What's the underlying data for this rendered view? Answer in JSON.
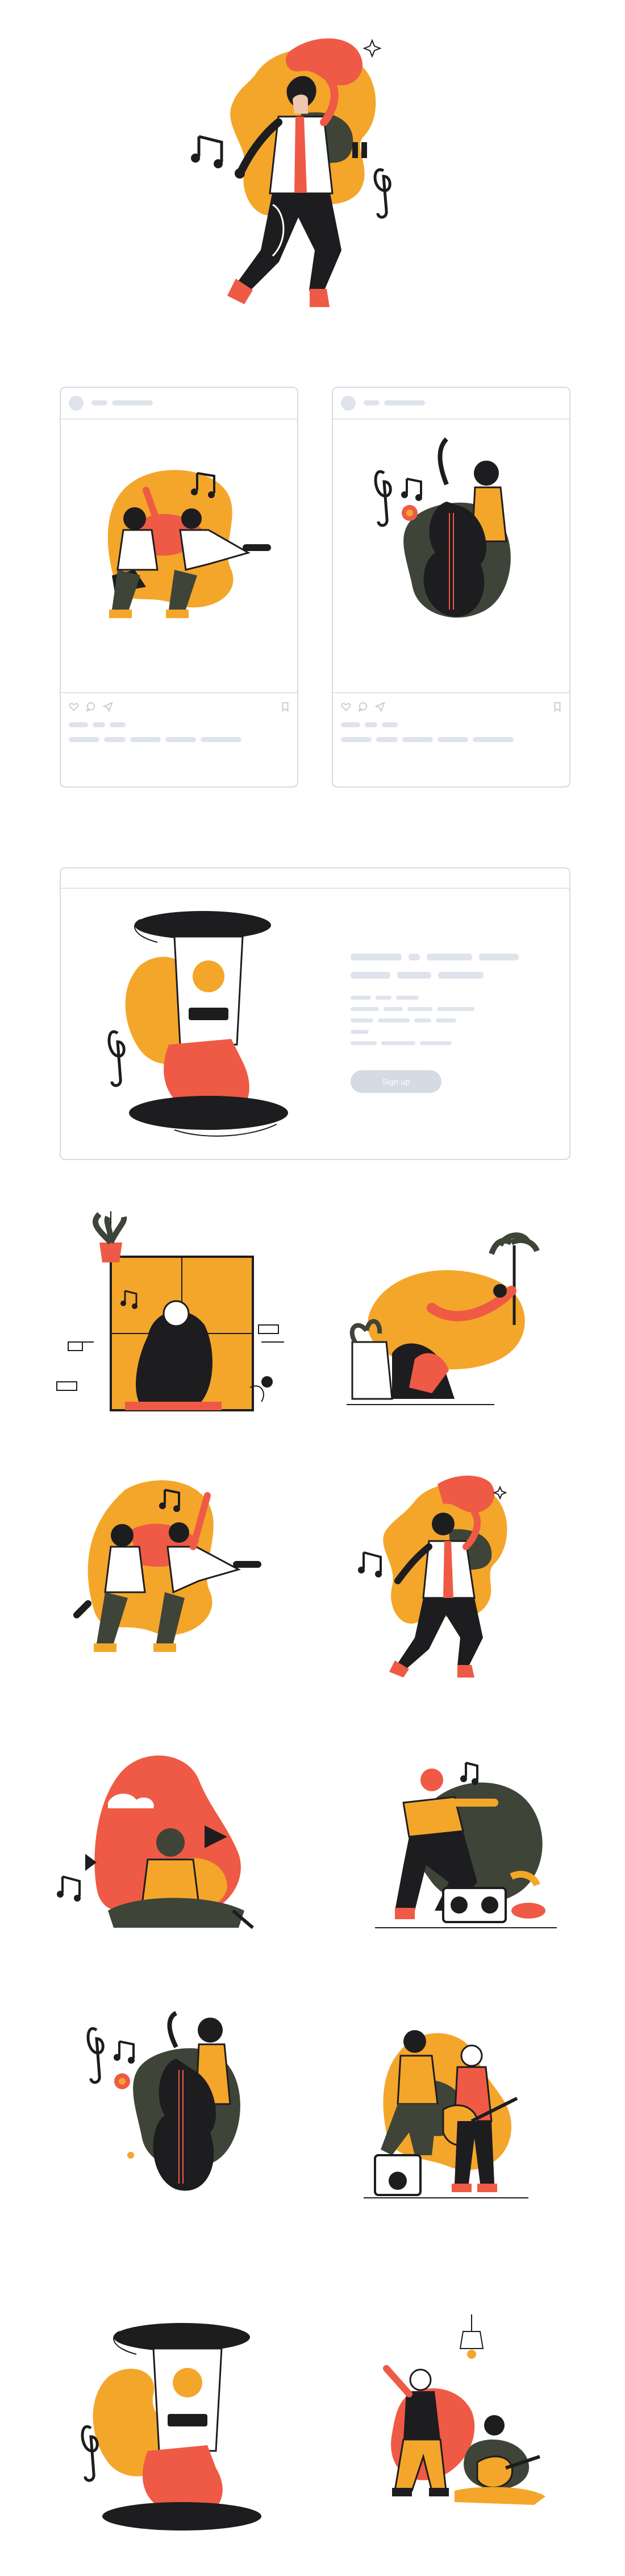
{
  "landing_card": {
    "signup_label": "Sign up"
  },
  "colors": {
    "orange": "#f4a62a",
    "red": "#ee5a45",
    "dark": "#1d1d1f",
    "olive": "#3f4438",
    "skeleton": "#dfe4ec",
    "border": "#d5dbe4"
  }
}
